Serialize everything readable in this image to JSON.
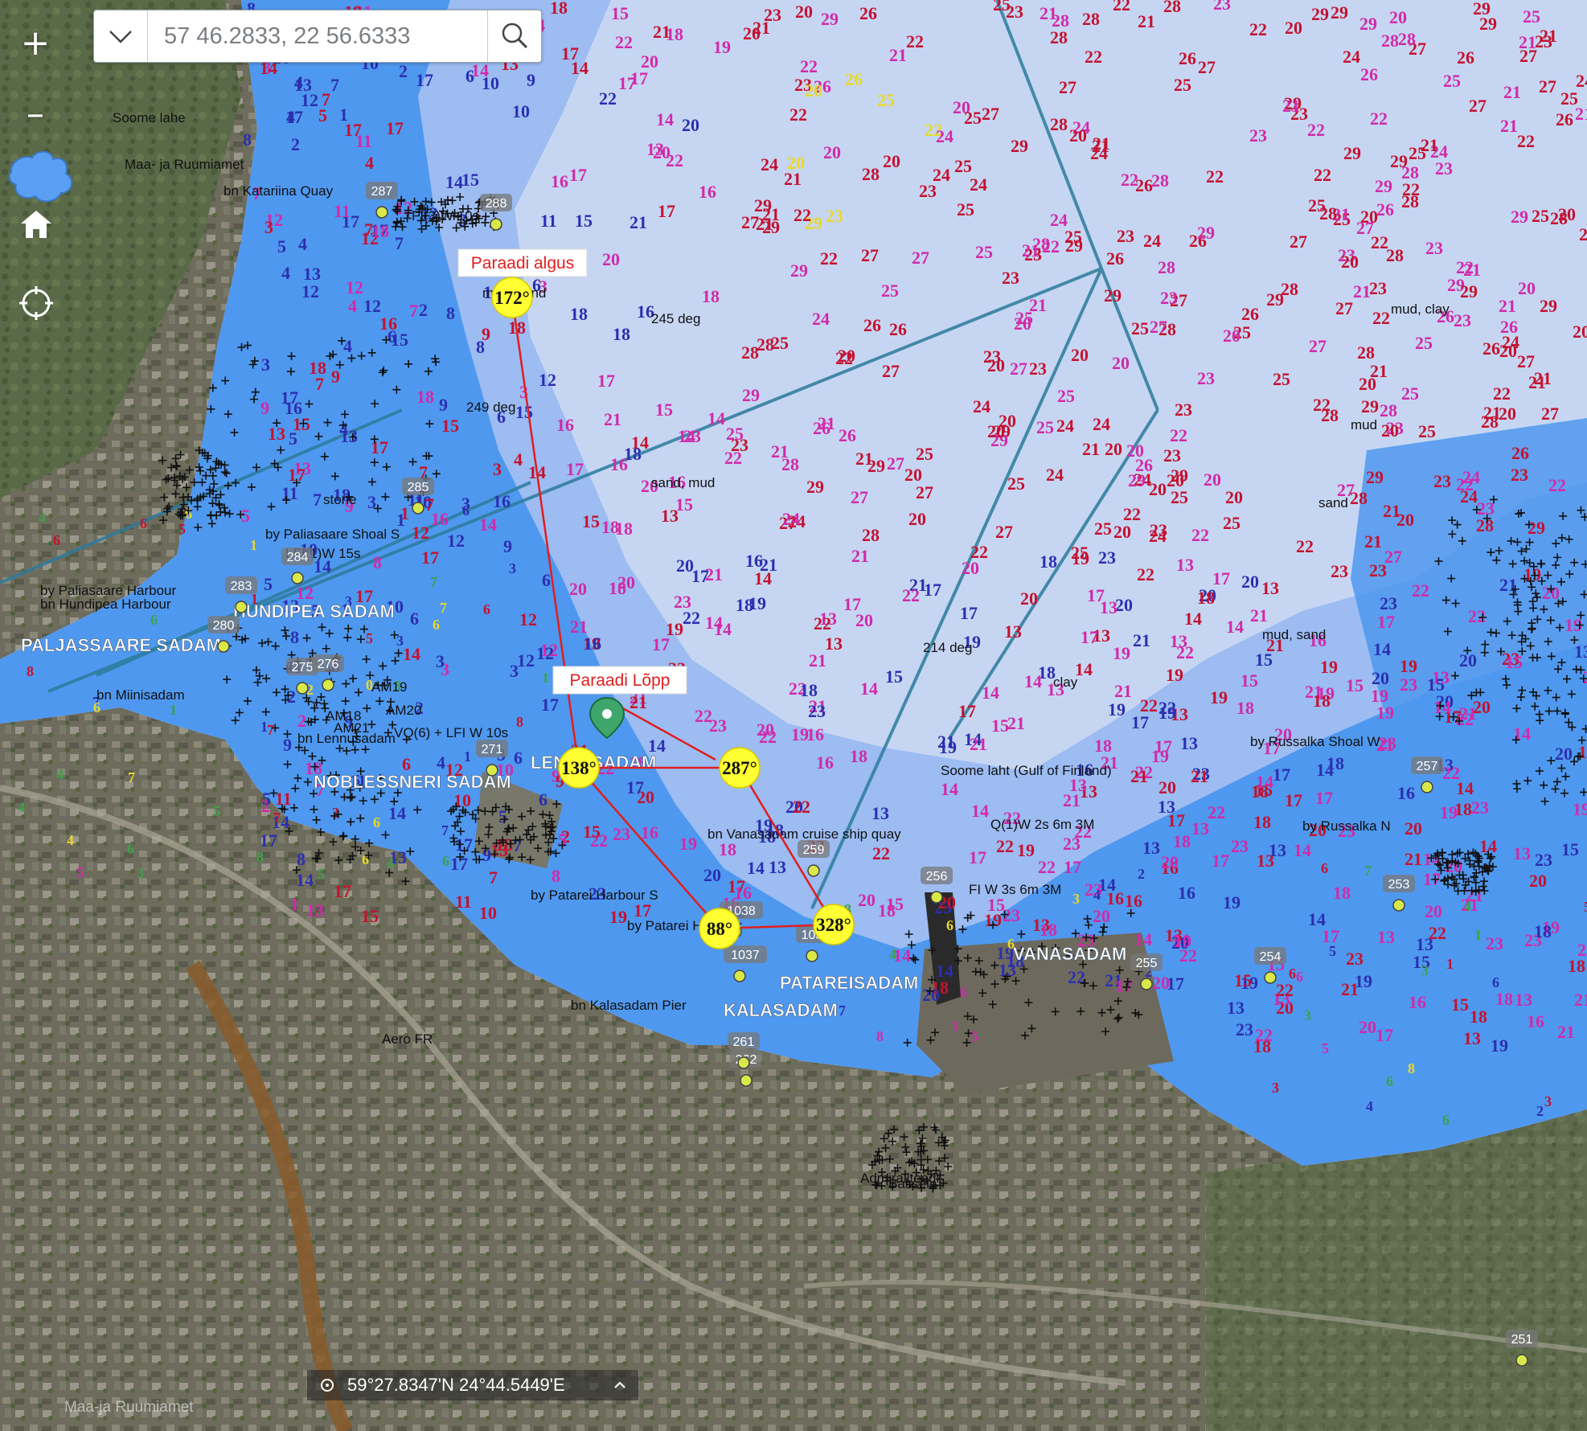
{
  "search": {
    "placeholder": "57 46.2833, 22 56.6333"
  },
  "controls": {
    "zoom_in": "+",
    "zoom_out": "–"
  },
  "coordinates": "59°27.8347'N 24°44.5449'E",
  "route": {
    "start_label": "Paraadi algus",
    "end_label": "Paraadi Lõpp",
    "waypoints": [
      {
        "label": "172°"
      },
      {
        "label": "138°"
      },
      {
        "label": "88°"
      },
      {
        "label": "328°"
      },
      {
        "label": "287°"
      }
    ]
  },
  "harbours": [
    "HUNDIPEA SADAM",
    "PALJASSAARE SADAM",
    "NOBLESSNERI SADAM",
    "LENNUSADAM",
    "PATAREISADAM",
    "KALASADAM",
    "VANASADAM"
  ],
  "chart_labels": [
    "Soome lahe",
    "Maa- ja Ruumiamet",
    "bn Katariina Quay",
    "FI(3)W 10s",
    "mud, sand",
    "249 deg",
    "sand, mud",
    "stone",
    "by Paliasaare Shoal S",
    "LFI(1)W 15s",
    "bn Hundipea Harbour",
    "by Paliasaare Harbour",
    "bn Miinisadam",
    "AM19",
    "AM18",
    "AM20",
    "AM21",
    "bn Lennusadam",
    "VQ(6) + LFI W 10s",
    "214 deg",
    "mud, sand",
    "clay",
    "mud, clay",
    "245 deg",
    "by Russalka Shoal W",
    "by Russalka N",
    "bn Vanasadam cruise ship quay",
    "Q(1)W 2s 6m 3M",
    "FI W 3s 6m 3M",
    "by Patarei Harbour S",
    "by Patarei Harbour",
    "bn Kalasadam Pier",
    "Soome laht (Gulf of Finland)",
    "Aero FR",
    "Admiraliteedi",
    "Bassein",
    "sand",
    "mud"
  ],
  "markers": [
    "287",
    "288",
    "285",
    "284",
    "283",
    "280",
    "275",
    "276",
    "271",
    "259",
    "256",
    "255",
    "254",
    "253",
    "257",
    "262",
    "261",
    "1038",
    "1037",
    "103",
    "251"
  ],
  "colors": {
    "deep_water": "#c6d6f2",
    "shallow_water": "#3d8fed",
    "land": "#6e6c5d",
    "route_line": "#e01e1e",
    "waypoint_fill": "#ffff33",
    "depth_red": "#c41230",
    "depth_magenta": "#d12aa9",
    "depth_blue": "#2b2fb0",
    "depth_yellow": "#e8d82a",
    "label_red": "#e0301f"
  }
}
